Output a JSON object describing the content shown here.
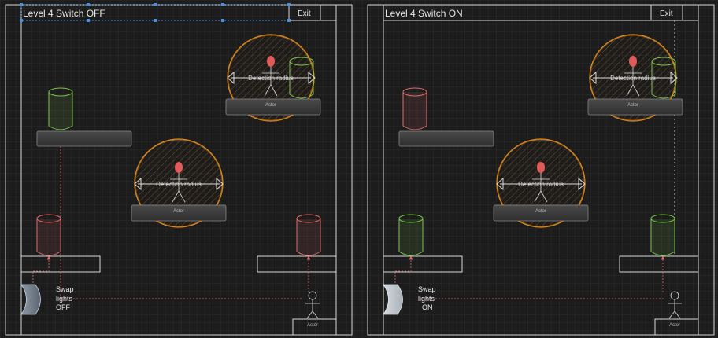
{
  "canvas": {
    "background": "#1c1c1c",
    "grid_color": "#2a2a2a"
  },
  "panels": [
    {
      "title": "Level 4 Switch OFF",
      "exit_label": "Exit",
      "detection_label": "Detection radius",
      "actor_label": "Actor",
      "swap_label": [
        "Swap",
        "lights",
        "OFF"
      ],
      "top_cylinder_color": "#7bc44a",
      "bottom_cylinder_color": "#e06a6a",
      "top_cylinder_state": "green",
      "bottom_cylinder_state": "red"
    },
    {
      "title": "Level 4 Switch ON",
      "exit_label": "Exit",
      "detection_label": "Detection radius",
      "actor_label": "Actor",
      "swap_label": [
        "Swap",
        "lights",
        "ON"
      ],
      "top_cylinder_color": "#e06a6a",
      "bottom_cylinder_color": "#7bc44a",
      "top_cylinder_state": "red",
      "bottom_cylinder_state": "green"
    }
  ],
  "colors": {
    "border": "#d8d8d8",
    "detection_circle": "#e08a1e",
    "enemy_head": "#e05a5a",
    "platform": "#3a3a3a",
    "link_line": "#e06a6a"
  }
}
